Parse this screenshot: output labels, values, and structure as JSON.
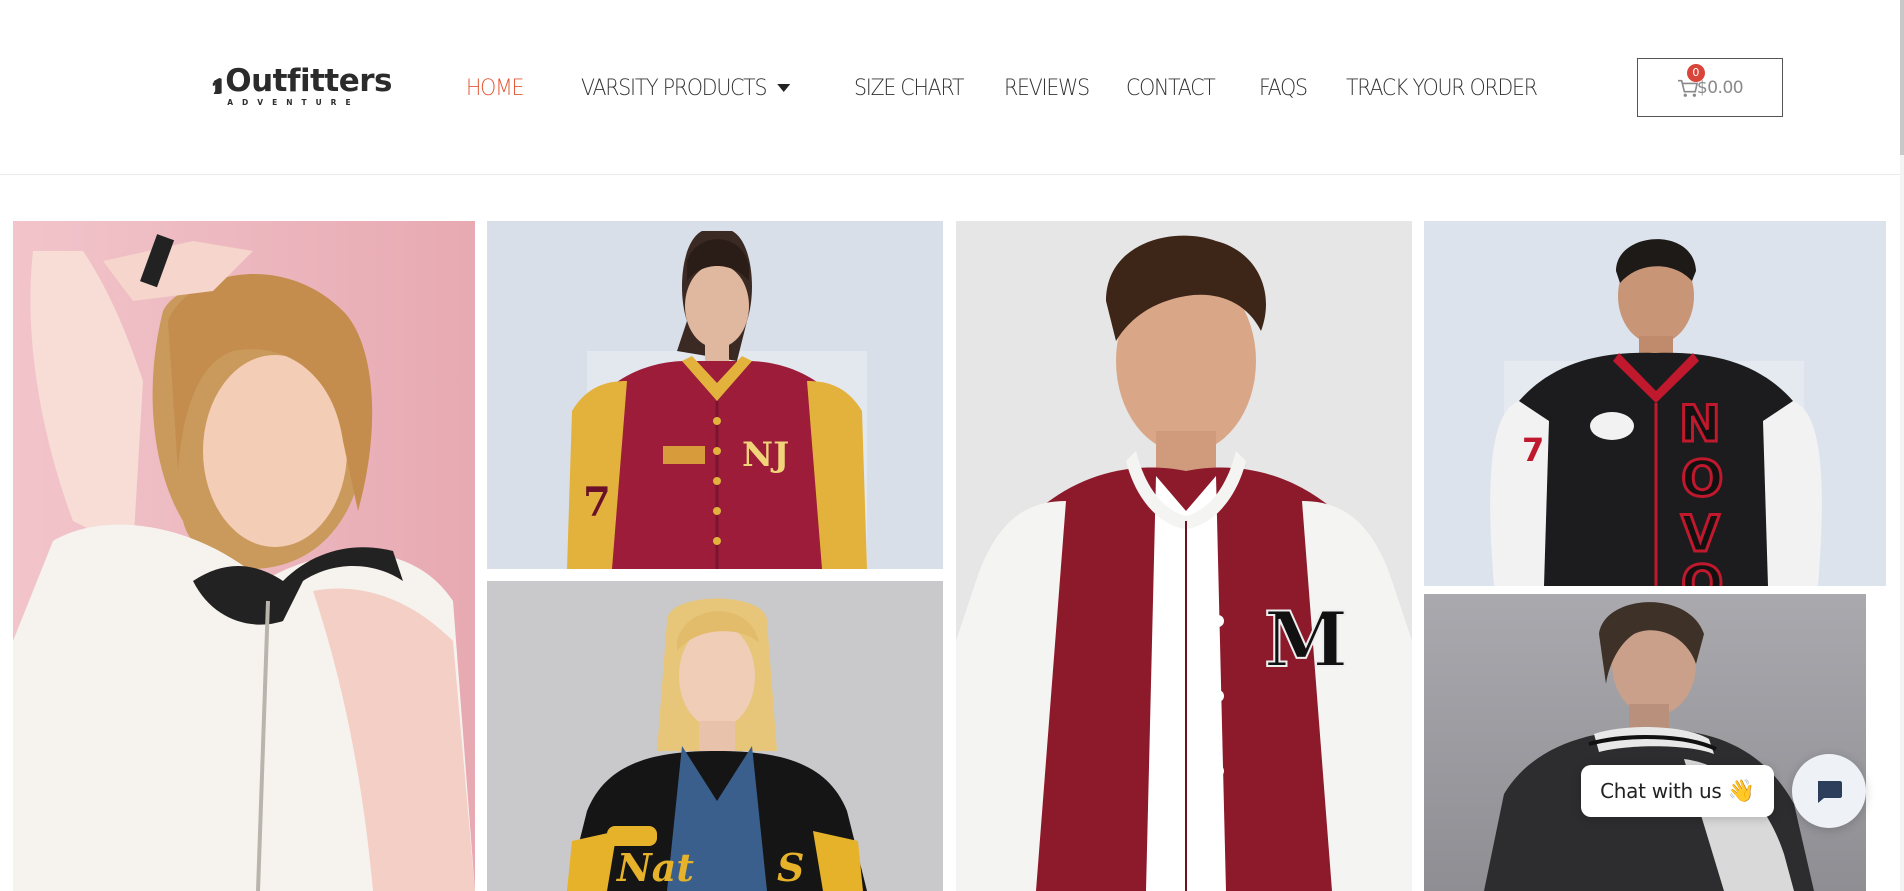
{
  "brand": {
    "name": "Outfitters",
    "tagline": "ADVENTURE"
  },
  "nav": {
    "items": [
      {
        "label": "HOME",
        "active": true
      },
      {
        "label": "VARSITY PRODUCTS",
        "dropdown": true
      },
      {
        "label": "SIZE CHART"
      },
      {
        "label": "REVIEWS"
      },
      {
        "label": "CONTACT"
      },
      {
        "label": "FAQS"
      },
      {
        "label": "TRACK YOUR ORDER"
      }
    ]
  },
  "cart": {
    "count": "0",
    "amount": "$0.00",
    "icon": "cart-icon"
  },
  "gallery": {
    "images": [
      {
        "name": "woman-pink-bomber-jacket",
        "icon": "photo"
      },
      {
        "name": "woman-maroon-gold-varsity-jacket",
        "icon": "photo"
      },
      {
        "name": "man-maroon-white-varsity-jacket",
        "icon": "photo"
      },
      {
        "name": "man-black-novo-varsity-jacket",
        "icon": "photo"
      },
      {
        "name": "woman-black-yellow-varsity-jacket",
        "icon": "photo"
      },
      {
        "name": "man-black-leather-varsity-jacket",
        "icon": "photo"
      }
    ]
  },
  "chat": {
    "label": "Chat with us",
    "emoji": "👋",
    "icon": "chat-icon"
  },
  "colors": {
    "accent": "#e25a3a",
    "badge": "#d9453a",
    "text": "#333333"
  }
}
